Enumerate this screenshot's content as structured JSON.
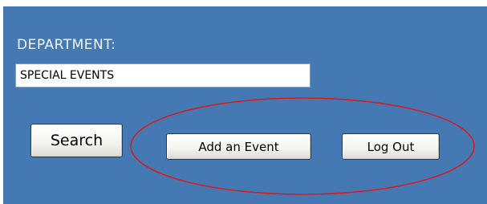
{
  "form": {
    "department_label": "DEPARTMENT:",
    "department_value": "SPECIAL EVENTS",
    "search_label": "Search",
    "add_event_label": "Add an Event",
    "logout_label": "Log Out"
  },
  "colors": {
    "panel_background": "#4479b3",
    "label_text": "#f2f6fb",
    "highlight_ellipse": "#e01818",
    "button_border": "#1f3b63"
  },
  "annotation": {
    "shape": "ellipse",
    "highlights": [
      "add-event-button",
      "logout-button"
    ]
  }
}
